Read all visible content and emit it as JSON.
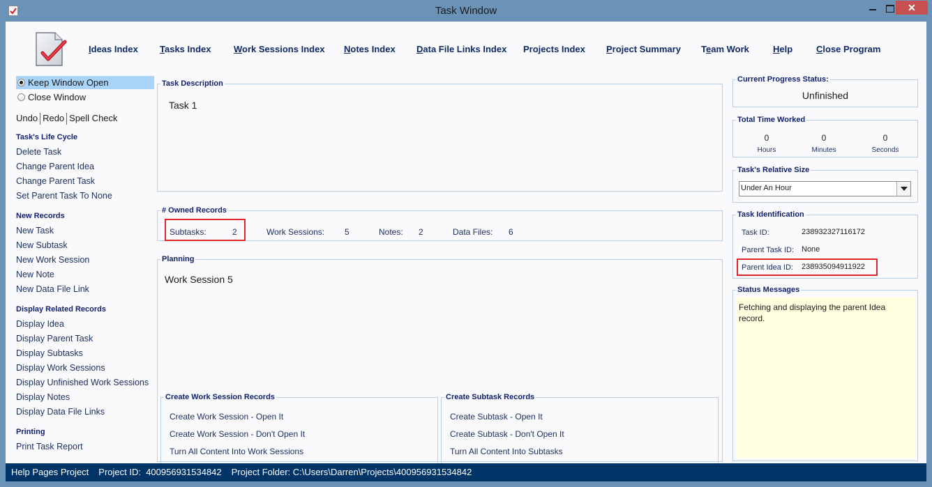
{
  "window": {
    "title": "Task Window",
    "controls": {
      "minimize": "minimize",
      "maximize": "maximize",
      "close": "✕"
    }
  },
  "topnav": [
    {
      "label": "Ideas Index",
      "mnemonic": "I"
    },
    {
      "label": "Tasks Index",
      "mnemonic": "T"
    },
    {
      "label": "Work Sessions Index",
      "mnemonic": "W"
    },
    {
      "label": "Notes Index",
      "mnemonic": "N"
    },
    {
      "label": "Data File Links Index",
      "mnemonic": "D"
    },
    {
      "label": "Projects Index",
      "mnemonic": ""
    },
    {
      "label": "Project Summary",
      "mnemonic": "P"
    },
    {
      "label": "Team Work",
      "mnemonic": "e"
    },
    {
      "label": "Help",
      "mnemonic": "H"
    },
    {
      "label": "Close Program",
      "mnemonic": "C"
    }
  ],
  "sidebar": {
    "window_options": [
      {
        "label": "Keep Window Open",
        "selected": true
      },
      {
        "label": "Close Window",
        "selected": false
      }
    ],
    "edit": {
      "undo": "Undo",
      "redo": "Redo",
      "spell_check": "Spell Check"
    },
    "sections": [
      {
        "heading": "Task's Life Cycle",
        "items": [
          "Delete Task",
          "Change Parent Idea",
          "Change Parent Task",
          "Set Parent Task To None"
        ]
      },
      {
        "heading": "New Records",
        "items": [
          "New Task",
          "New Subtask",
          "New Work Session",
          "New Note",
          "New Data File Link"
        ]
      },
      {
        "heading": "Display Related Records",
        "items": [
          "Display Idea",
          "Display Parent Task",
          "Display Subtasks",
          "Display Work Sessions",
          "Display Unfinished Work Sessions",
          "Display Notes",
          "Display Data File Links"
        ]
      },
      {
        "heading": "Printing",
        "items": [
          "Print Task Report"
        ]
      }
    ]
  },
  "main": {
    "task_description": {
      "label": "Task Description",
      "value": "Task 1"
    },
    "owned_records": {
      "label": "# Owned Records",
      "items": [
        {
          "label": "Subtasks:",
          "value": "2"
        },
        {
          "label": "Work Sessions:",
          "value": "5"
        },
        {
          "label": "Notes:",
          "value": "2"
        },
        {
          "label": "Data Files:",
          "value": "6"
        }
      ]
    },
    "planning": {
      "label": "Planning",
      "value": "Work Session 5"
    },
    "create_work_sessions": {
      "label": "Create Work Session Records",
      "items": [
        "Create Work Session - Open It",
        "Create Work Session - Don't Open It",
        "Turn All Content Into Work Sessions"
      ]
    },
    "create_subtasks": {
      "label": "Create Subtask Records",
      "items": [
        "Create Subtask - Open It",
        "Create Subtask - Don't Open It",
        "Turn All Content Into Subtasks"
      ]
    }
  },
  "right": {
    "progress": {
      "label": "Current Progress Status:",
      "value": "Unfinished"
    },
    "time_worked": {
      "label": "Total Time Worked",
      "items": [
        {
          "value": "0",
          "unit": "Hours"
        },
        {
          "value": "0",
          "unit": "Minutes"
        },
        {
          "value": "0",
          "unit": "Seconds"
        }
      ]
    },
    "relative_size": {
      "label": "Task's Relative Size",
      "selected": "Under An Hour"
    },
    "identification": {
      "label": "Task Identification",
      "task_id_label": "Task ID:",
      "task_id": "238932327116172",
      "parent_task_label": "Parent Task ID:",
      "parent_task_id": "None",
      "parent_idea_label": "Parent Idea ID:",
      "parent_idea_id": "238935094911922"
    },
    "status_messages": {
      "label": "Status Messages",
      "text": "Fetching and displaying the parent Idea record."
    }
  },
  "statusbar": {
    "project_name": "Help Pages Project",
    "project_id": "Project ID:  400956931534842",
    "project_folder": "Project Folder: C:\\Users\\Darren\\Projects\\400956931534842"
  },
  "colors": {
    "frame": "#6b93b8",
    "status_bar": "#003366",
    "heading": "#0f1f6b",
    "highlight": "#e0242a",
    "selected_row": "#a9d3f7",
    "message_bg": "#ffffe0",
    "close_button": "#c75050"
  }
}
